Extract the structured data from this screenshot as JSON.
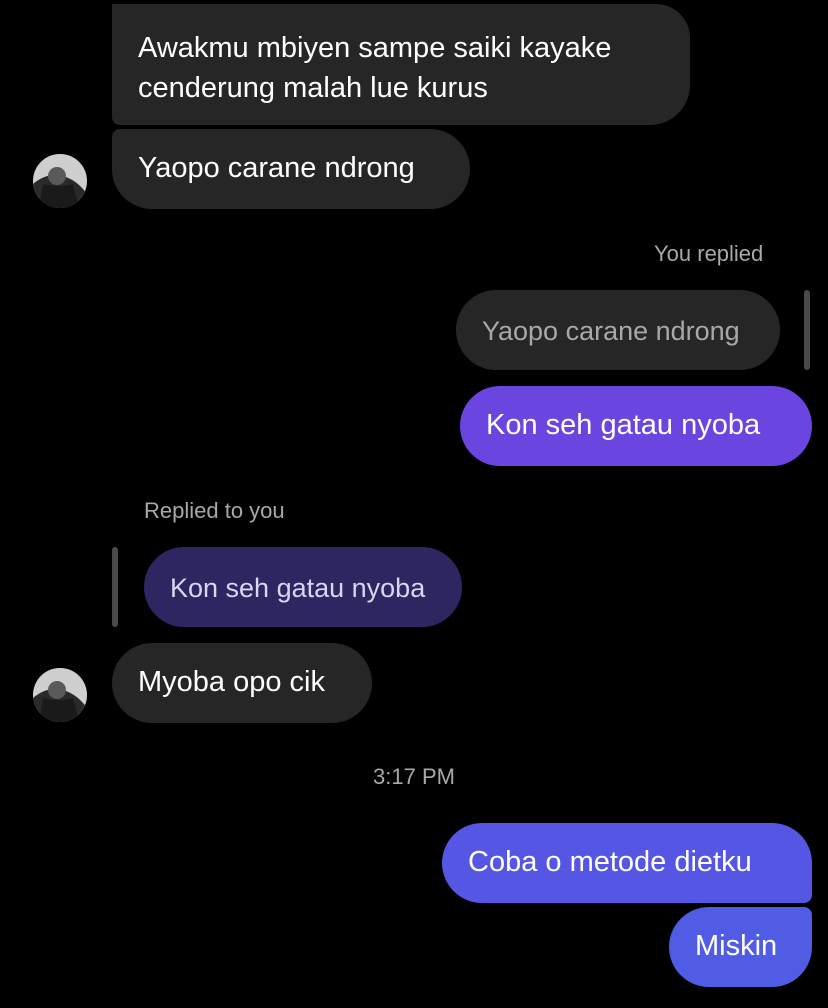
{
  "thread": {
    "messages": [
      {
        "sender": "them",
        "text": "Awakmu mbiyen sampe saiki kayake\ncenderung malah lue kurus"
      },
      {
        "sender": "them",
        "text": "Yaopo carane ndrong"
      },
      {
        "sender": "me",
        "reply_label": "You replied",
        "quoted_text": "Yaopo carane ndrong",
        "text": "Kon seh gatau nyoba"
      },
      {
        "sender": "them",
        "reply_label": "Replied to you",
        "quoted_text": "Kon seh gatau nyoba",
        "text": "Myoba opo cik"
      },
      {
        "sender": "me",
        "text": "Coba o metode dietku"
      },
      {
        "sender": "me",
        "text": "Miskin"
      }
    ],
    "timestamp": "3:17 PM"
  },
  "avatar": {
    "icon": "contact-avatar-photo"
  },
  "colors": {
    "background": "#000000",
    "incoming_bubble": "#262626",
    "outgoing_gradient_top": "#6b45e0",
    "outgoing_gradient_bottom": "#4f5ce3",
    "reply_quote_in": "#2d2660",
    "meta_text": "#a8a8a8"
  }
}
